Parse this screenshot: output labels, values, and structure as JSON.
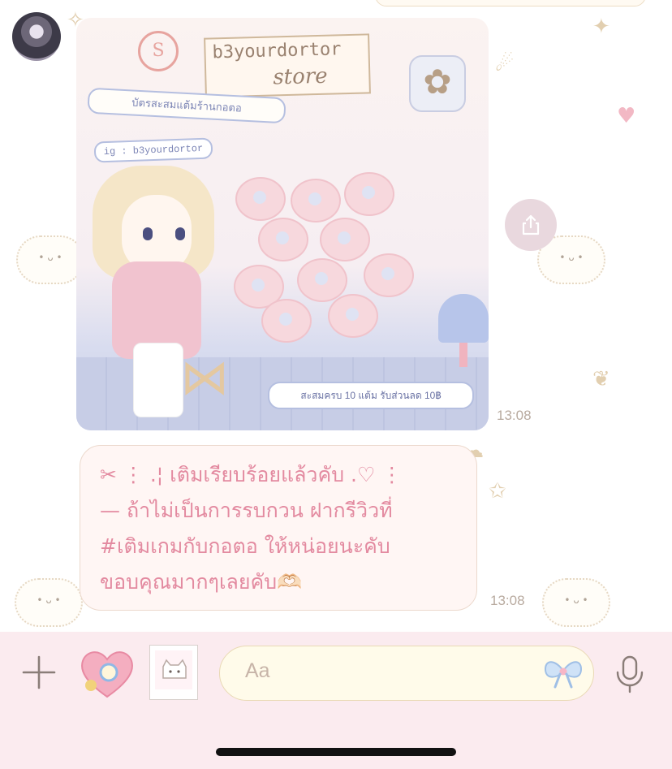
{
  "chat": {
    "image_message": {
      "store_name_line1": "b3yourdortor",
      "store_name_line2": "store",
      "card_subtitle": "บัตรสะสมแต้มร้านกอตอ",
      "card_handle": "ig : b3yourdortor",
      "card_footer": "สะสมครบ 10 แต้ม รับส่วนลด 10฿",
      "stamp_count_total": 10,
      "time": "13:08"
    },
    "text_message": {
      "lines": [
        "✂︎ ⋮ .¦ เติมเรียบร้อยแล้วคับ .♡ ⋮",
        "— ถ้าไม่เป็นการรบกวน ฝากรีวิวที่",
        "#เติมเกมกับกอตอ ให้หน่อยนะคับ",
        "ขอบคุณมากๆเลยคับ🫶🏻"
      ],
      "time": "13:08"
    }
  },
  "composer": {
    "input_placeholder": "Aa"
  },
  "colors": {
    "text_pink": "#e38aa0",
    "compose_bg": "#fbebef",
    "time_gray": "#b8aa9f"
  }
}
